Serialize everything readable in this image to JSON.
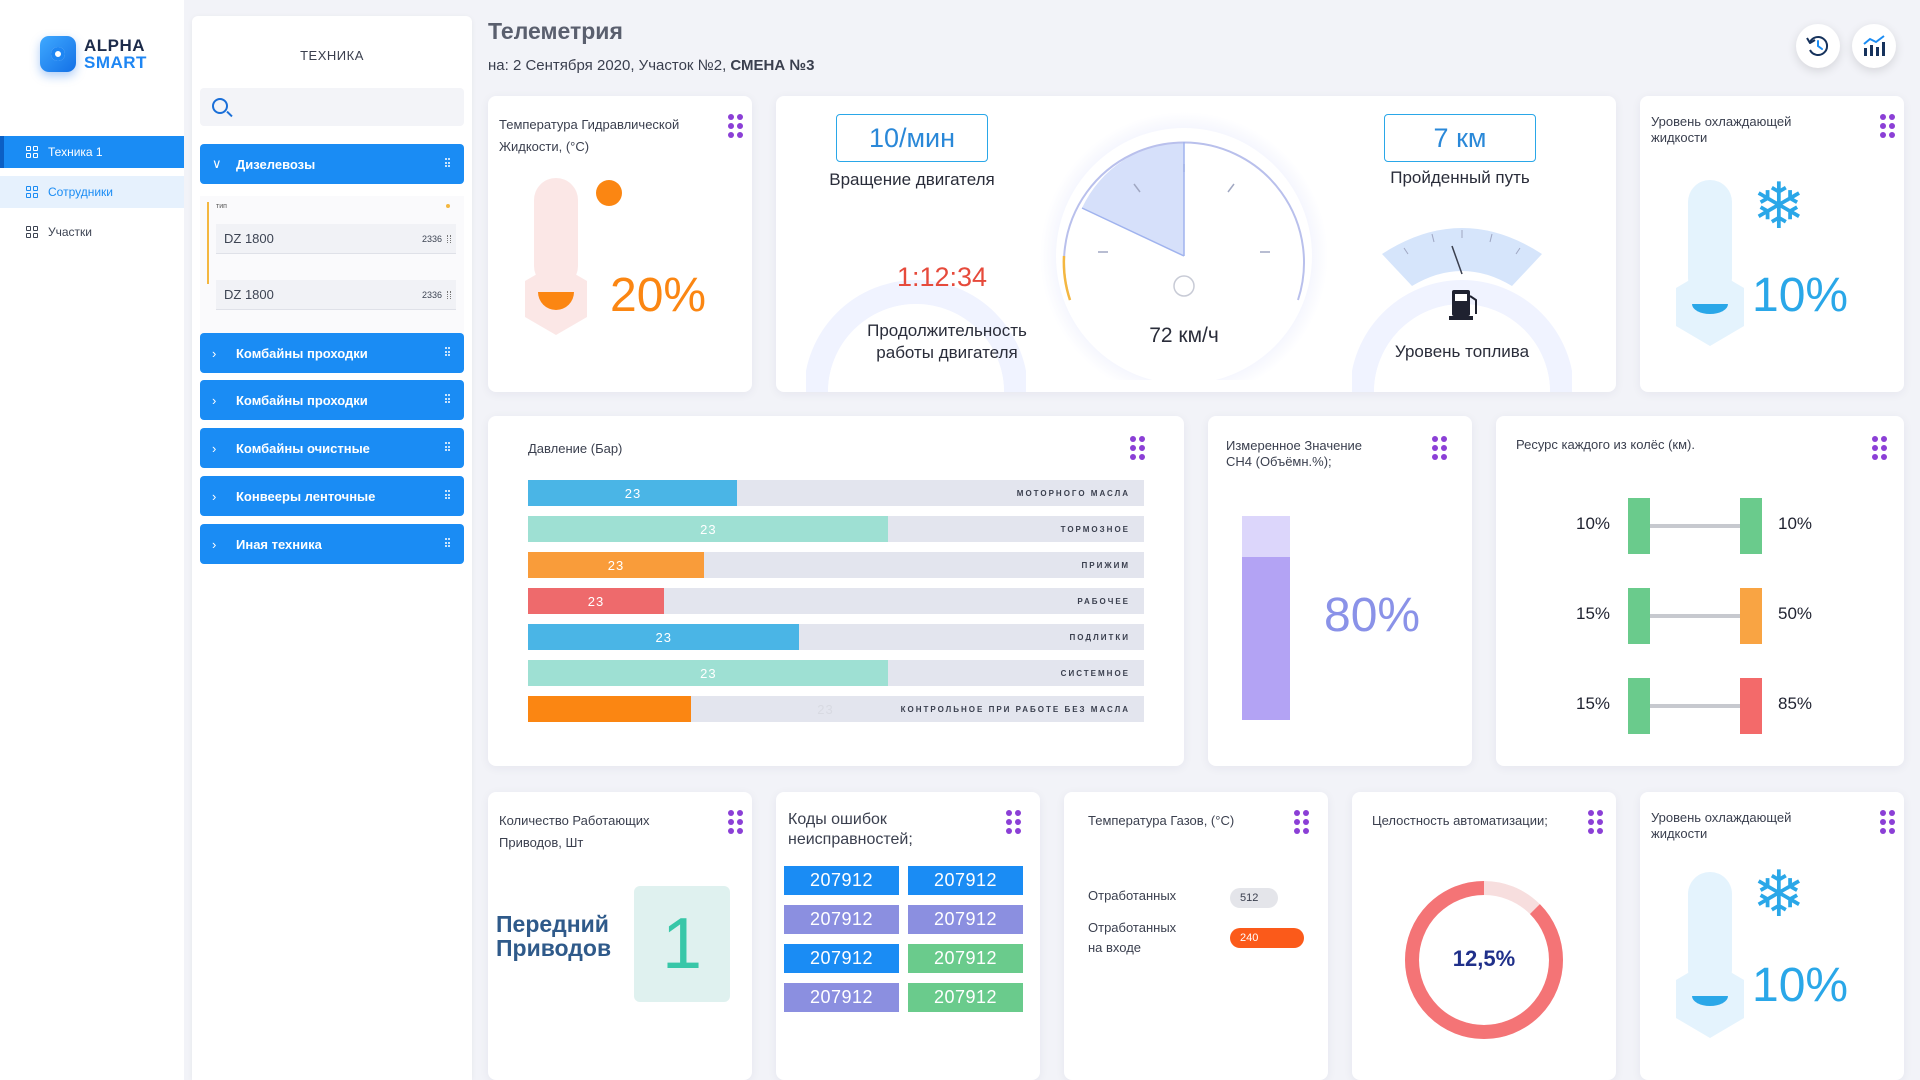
{
  "brand": {
    "line1": "ALPHA",
    "line2": "SMART"
  },
  "nav": [
    {
      "label": "Техника 1"
    },
    {
      "label": "Сотрудники"
    },
    {
      "label": "Участки"
    }
  ],
  "tech_panel": {
    "title": "ТЕХНИКА",
    "search_placeholder": "",
    "categories": [
      {
        "label": "Дизелевозы",
        "expanded": true
      },
      {
        "label": "Комбайны проходки"
      },
      {
        "label": "Комбайны проходки"
      },
      {
        "label": "Комбайны очистные"
      },
      {
        "label": "Конвееры ленточные"
      },
      {
        "label": "Иная техника"
      }
    ],
    "sub_type_label": "тип",
    "sub_items": [
      {
        "name": "DZ 1800",
        "num": "2336"
      },
      {
        "name": "DZ 1800",
        "num": "2336"
      }
    ]
  },
  "header": {
    "title": "Телеметрия",
    "subtitle_prefix": "на: 2 Сентября 2020,  Участок №2, ",
    "subtitle_shift": "СМЕНА №3"
  },
  "hydraulic": {
    "title_l1": "Температура Гидравлической",
    "title_l2": "Жидкости, (°С)",
    "value": "20%",
    "level": 0.2
  },
  "engine": {
    "rpm_value": "10/мин",
    "rpm_label": "Вращение двигателя",
    "duration_value": "1:12:34",
    "duration_label_l1": "Продолжительность",
    "duration_label_l2": "работы двигателя",
    "speed_value": "72 км/ч",
    "distance_value": "7 км",
    "distance_label": "Пройденный путь",
    "fuel_label": "Уровень топлива"
  },
  "coolant_top": {
    "title_l1": "Уровень охлаждающей",
    "title_l2": "жидкости",
    "value": "10%",
    "level": 0.1
  },
  "pressure": {
    "title": "Давление (Бар)",
    "rows": [
      {
        "value": "23",
        "label": "МОТОРНОГО МАСЛА",
        "fill": 0.34,
        "color": "#4ab5e6"
      },
      {
        "value": "23",
        "label": "ТОРМОЗНОЕ",
        "fill": 0.585,
        "color": "#9ee0d3"
      },
      {
        "value": "23",
        "label": "ПРИЖИМ",
        "fill": 0.285,
        "color": "#f99c3a"
      },
      {
        "value": "23",
        "label": "РАБОЧЕЕ",
        "fill": 0.22,
        "color": "#ee6a6c"
      },
      {
        "value": "23",
        "label": "ПОДЛИТКИ",
        "fill": 0.44,
        "color": "#4ab5e6"
      },
      {
        "value": "23",
        "label": "СИСТЕМНОЕ",
        "fill": 0.585,
        "color": "#9ee0d3"
      },
      {
        "value": "23",
        "label": "КОНТРОЛЬНОЕ ПРИ РАБОТЕ БЕЗ МАСЛА",
        "fill": 0.265,
        "color": "#fb8612"
      }
    ]
  },
  "ch4": {
    "title_l1": "Измеренное Значение",
    "title_l2": "СН4 (Объёмн.%);",
    "value": "80%",
    "level": 0.8
  },
  "wheels": {
    "title": "Ресурс каждого из колёс (км).",
    "axles": [
      {
        "left": "10%",
        "right": "10%",
        "left_color": "#6acb8c",
        "right_color": "#6acb8c"
      },
      {
        "left": "15%",
        "right": "50%",
        "left_color": "#6acb8c",
        "right_color": "#f9a443"
      },
      {
        "left": "15%",
        "right": "85%",
        "left_color": "#6acb8c",
        "right_color": "#f36a6a"
      }
    ]
  },
  "drives": {
    "title_l1": "Количество Работающих",
    "title_l2": "Приводов, Шт",
    "label_l1": "Передний",
    "label_l2": "Приводов",
    "value": "1"
  },
  "errors": {
    "title_l1": "Коды ошибок",
    "title_l2": "неисправностей;",
    "codes": [
      {
        "code": "207912",
        "color": "#1a8cf4"
      },
      {
        "code": "207912",
        "color": "#1a8cf4"
      },
      {
        "code": "207912",
        "color": "#8b8fe0"
      },
      {
        "code": "207912",
        "color": "#8b8fe0"
      },
      {
        "code": "207912",
        "color": "#1a8cf4"
      },
      {
        "code": "207912",
        "color": "#6acb8c"
      },
      {
        "code": "207912",
        "color": "#8b8fe0"
      },
      {
        "code": "207912",
        "color": "#6acb8c"
      }
    ]
  },
  "gas": {
    "title": "Температура Газов, (°С)",
    "row1_label": "Отработанных",
    "row1_value": "512",
    "row2_label_l1": "Отработанных",
    "row2_label_l2": "на входе",
    "row2_value": "240"
  },
  "automation": {
    "title": "Целостность автоматизации;",
    "value": "12,5%",
    "fraction": 0.875
  },
  "coolant_bottom": {
    "title_l1": "Уровень охлаждающей",
    "title_l2": "жидкости",
    "value": "10%",
    "level": 0.1
  },
  "colors": {
    "accent": "#1a8cf4",
    "menu_dots": "#8b3fd6",
    "orange": "#fb8612",
    "cyan": "#2aa7e8",
    "lilac": "#8a92e8"
  }
}
